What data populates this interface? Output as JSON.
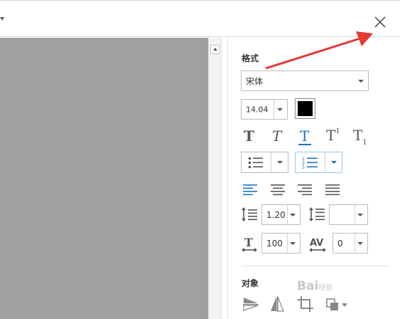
{
  "panel": {
    "format_title": "格式",
    "font_family": "宋体",
    "font_size": "14.04",
    "text_color": "#000000",
    "line_spacing": "1.20",
    "paragraph_spacing": "",
    "char_scale": "100",
    "char_spacing": "0",
    "object_title": "对象"
  },
  "icons": {
    "close": "close-icon",
    "bold": "bold-text-icon",
    "italic": "italic-text-icon",
    "underline": "underline-text-icon",
    "superscript": "superscript-icon",
    "subscript": "subscript-icon",
    "bullets": "bulleted-list-icon",
    "numbered": "numbered-list-icon",
    "align_left": "align-left-icon",
    "align_center": "align-center-icon",
    "align_right": "align-right-icon",
    "justify": "justify-icon",
    "line_spacing": "line-spacing-icon",
    "paragraph_spacing": "paragraph-spacing-icon",
    "char_scale": "horizontal-scale-icon",
    "char_spacing": "character-spacing-icon",
    "flip_vertical": "flip-vertical-icon",
    "flip_horizontal": "flip-horizontal-icon",
    "crop": "crop-icon",
    "arrange": "arrange-icon"
  },
  "colors": {
    "accent": "#1a73c8",
    "annotation_arrow": "#e53935",
    "canvas": "#a0a0a0"
  },
  "watermark": {
    "text": "Bai",
    "suffix": "经验"
  }
}
